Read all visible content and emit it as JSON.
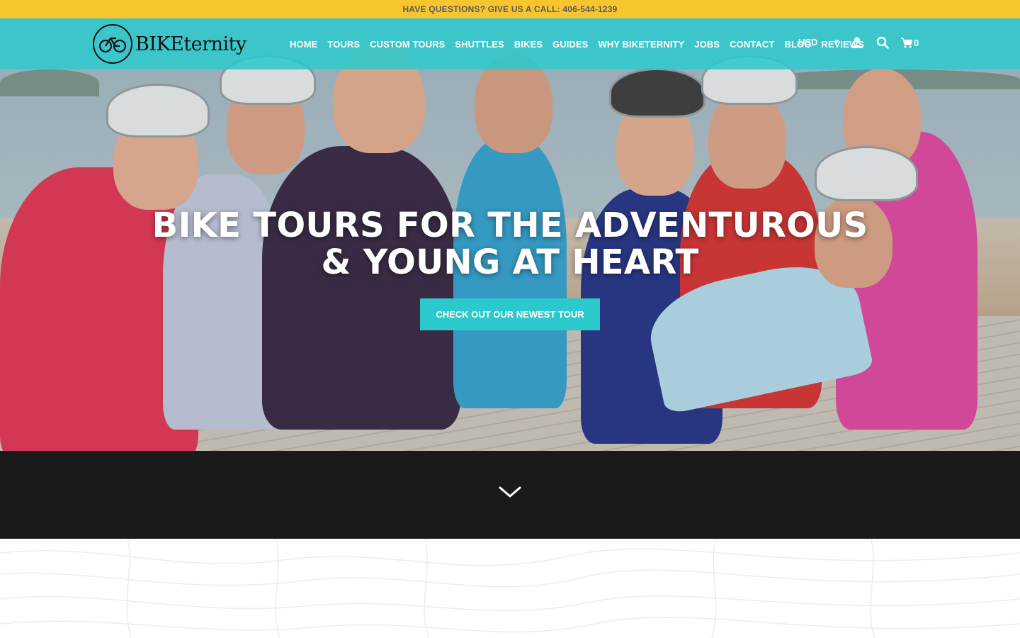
{
  "announcement": {
    "text": "HAVE QUESTIONS? GIVE US A CALL: 406-544-1239"
  },
  "header": {
    "logo_text": "BIKEternity",
    "nav": [
      {
        "label": "HOME"
      },
      {
        "label": "TOURS"
      },
      {
        "label": "CUSTOM TOURS"
      },
      {
        "label": "SHUTTLES"
      },
      {
        "label": "BIKES"
      },
      {
        "label": "GUIDES"
      },
      {
        "label": "WHY BIKETERNITY"
      },
      {
        "label": "JOBS"
      },
      {
        "label": "CONTACT"
      },
      {
        "label": "BLOG"
      },
      {
        "label": "REVIEWS"
      }
    ],
    "currency": "USD",
    "cart_count": "0",
    "icons": [
      "user-icon",
      "search-icon",
      "cart-icon",
      "chevron-down-icon"
    ]
  },
  "hero": {
    "title_line1": "BIKE TOURS FOR THE ADVENTUROUS",
    "title_line2": "& YOUNG AT HEART",
    "cta_label": "CHECK OUT OUR NEWEST TOUR"
  },
  "colors": {
    "announcement_bg": "#f7c62f",
    "header_bg": "#2bc8cc",
    "cta_bg": "#2bc8cc",
    "text_white": "#ffffff"
  }
}
